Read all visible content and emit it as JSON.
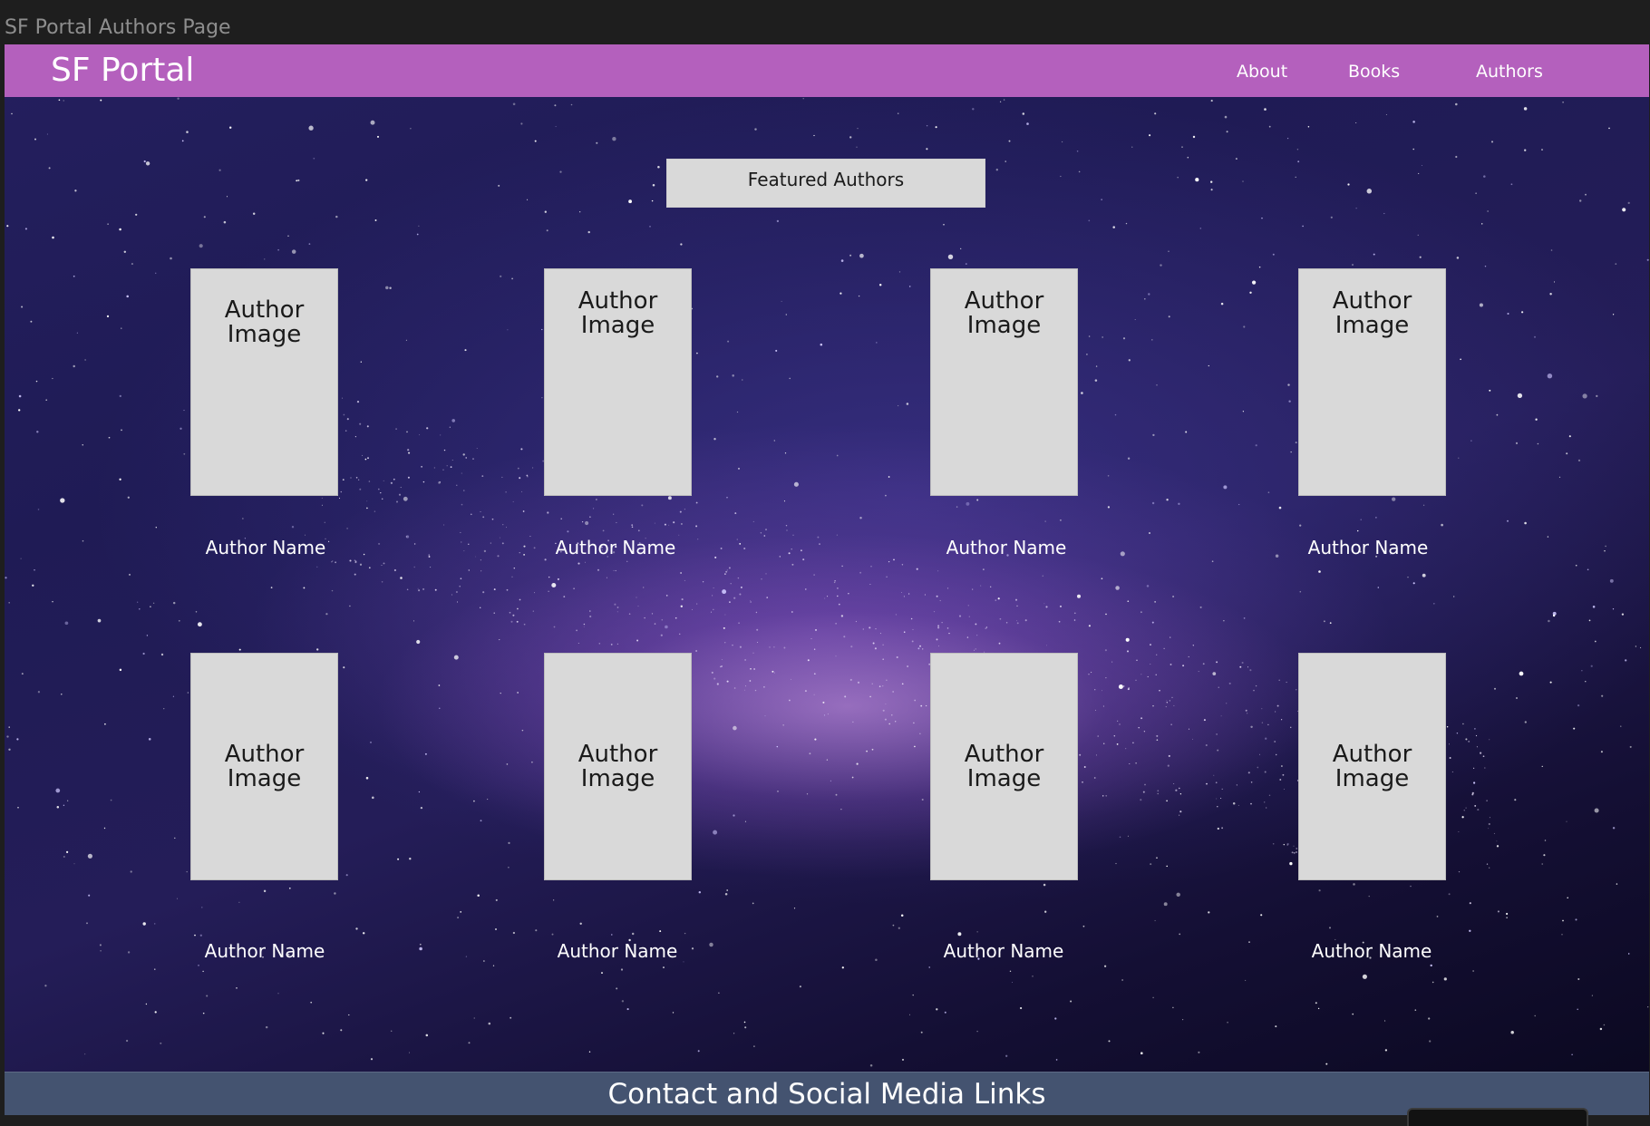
{
  "window": {
    "title": "SF Portal Authors Page"
  },
  "navbar": {
    "brand": "SF Portal",
    "links": [
      "About",
      "Books",
      "Authors"
    ],
    "background_color": "#b460bd"
  },
  "featured": {
    "heading": "Featured Authors"
  },
  "authors": [
    {
      "image_label": "Author\nImage",
      "name": "Author Name"
    },
    {
      "image_label": "Author\nImage",
      "name": "Author Name"
    },
    {
      "image_label": "Author\nImage",
      "name": "Author Name"
    },
    {
      "image_label": "Author\nImage",
      "name": "Author Name"
    },
    {
      "image_label": "Author\nImage",
      "name": "Author Name"
    },
    {
      "image_label": "Author\nImage",
      "name": "Author Name"
    },
    {
      "image_label": "Author\nImage",
      "name": "Author Name"
    },
    {
      "image_label": "Author\nImage",
      "name": "Author Name"
    }
  ],
  "footer": {
    "label": "Contact and Social Media Links",
    "background_color": "#445370"
  },
  "colors": {
    "placeholder_gray": "#d9d9d9",
    "background_theme": "night sky / milky way"
  }
}
